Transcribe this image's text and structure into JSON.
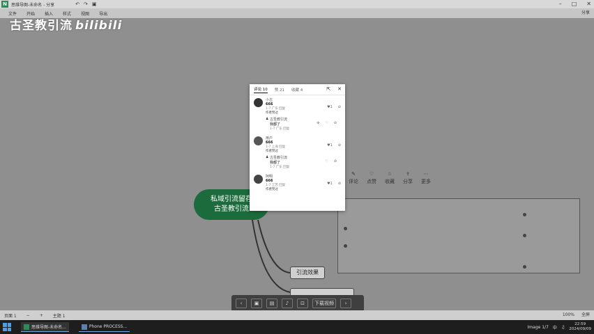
{
  "app": {
    "logo": "N",
    "title": "思维导图-未命名 - 分享"
  },
  "window": {
    "controls": [
      "min-icon",
      "max-icon",
      "close-icon"
    ]
  },
  "menubar": {
    "items": [
      "文件",
      "开始",
      "插入",
      "样式",
      "视图",
      "导出"
    ],
    "right": "分享"
  },
  "watermark": {
    "text": "古圣教引流",
    "brand": "bilibili"
  },
  "mindmap": {
    "root": {
      "line1": "私域引流留存",
      "line2": "古圣教引流"
    },
    "child": {
      "label": "引流效果"
    }
  },
  "float_tools": [
    "评论",
    "点赞",
    "收藏",
    "分享",
    "更多"
  ],
  "popup": {
    "tabs": [
      {
        "label": "评论 10",
        "active": true
      },
      {
        "label": "赞 21",
        "active": false
      },
      {
        "label": "收藏 4",
        "active": false
      }
    ],
    "comments": [
      {
        "name": "小古",
        "text": "666",
        "meta": "1-7 广东  回复",
        "tag": "作者赞过",
        "likes": "1",
        "reply": {
          "name": "古圣教引流",
          "text": "我都了",
          "meta": "1-7 广东  回复"
        }
      },
      {
        "name": "用户",
        "text": "666",
        "meta": "1-7 上海  回复",
        "tag": "作者赞过",
        "likes": "1",
        "reply": {
          "name": "古圣教引流",
          "text": "我都了",
          "meta": "1-7 广东  回复"
        }
      },
      {
        "name": "阿明",
        "text": "666",
        "meta": "1-7 江苏  回复",
        "tag": "作者赞过",
        "likes": "1"
      }
    ]
  },
  "player": {
    "download_label": "下载视频"
  },
  "statusbar": {
    "left": [
      "页面 1",
      "−",
      "+"
    ],
    "page": "主题 1",
    "right": [
      "100%",
      "全屏"
    ]
  },
  "taskbar": {
    "tasks": [
      {
        "label": "思维导图-未命名...",
        "active": true
      },
      {
        "label": "Phone PROCESS...",
        "active": false
      }
    ],
    "tray": {
      "ime": "中",
      "time": "22:59",
      "date": "2024/09/09",
      "status": "Image 1/7"
    }
  }
}
